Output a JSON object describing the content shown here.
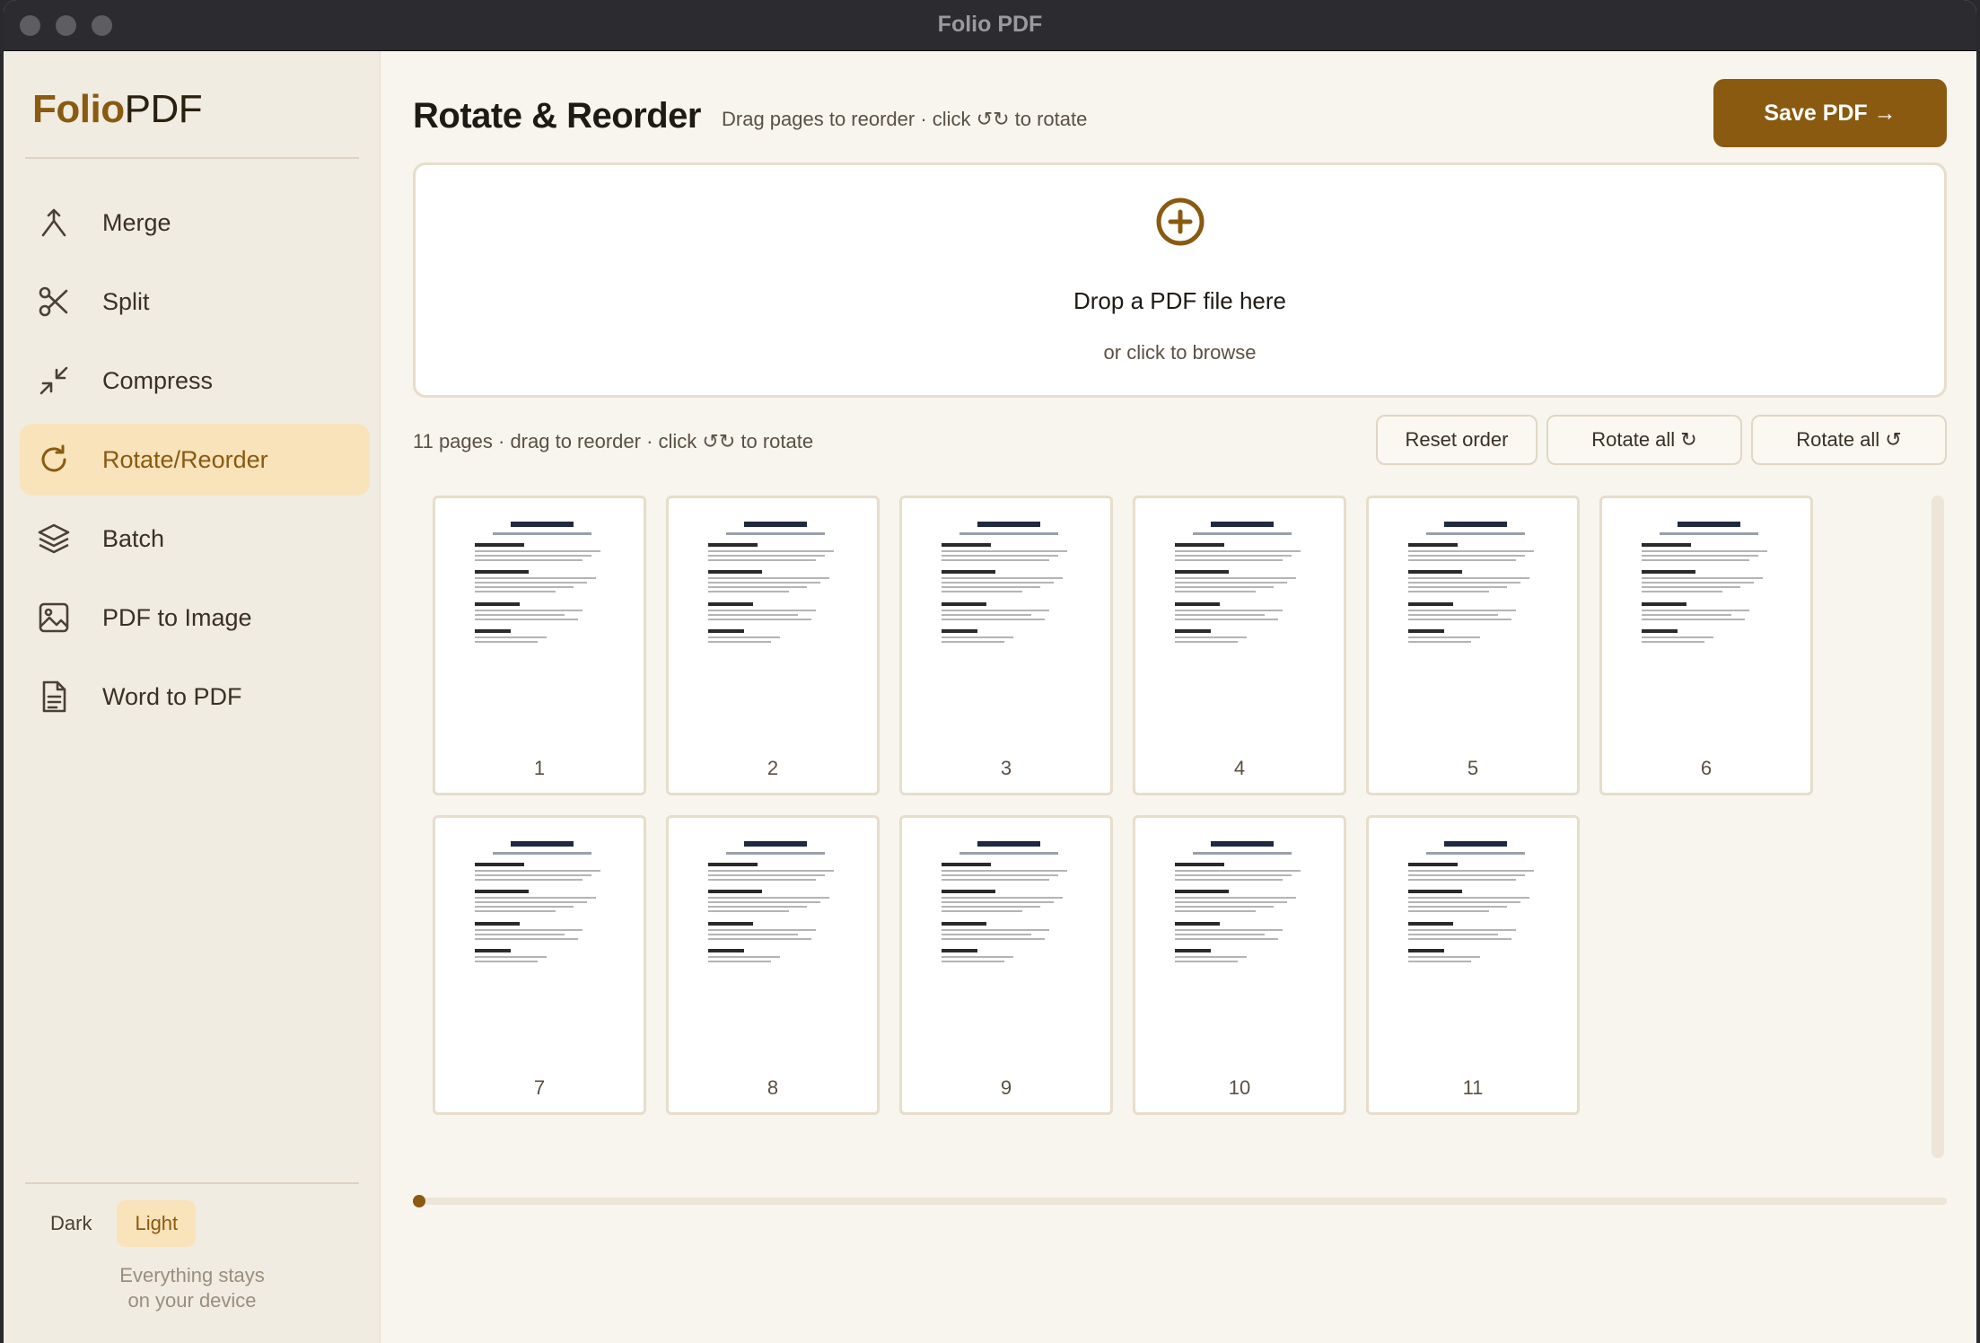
{
  "window": {
    "title": "Folio PDF"
  },
  "sidebar": {
    "brand_bold": "Folio",
    "brand_light": "PDF",
    "items": [
      {
        "label": "Merge",
        "icon": "merge-icon",
        "active": false
      },
      {
        "label": "Split",
        "icon": "scissors-icon",
        "active": false
      },
      {
        "label": "Compress",
        "icon": "compress-icon",
        "active": false
      },
      {
        "label": "Rotate/Reorder",
        "icon": "rotate-icon",
        "active": true
      },
      {
        "label": "Batch",
        "icon": "layers-icon",
        "active": false
      },
      {
        "label": "PDF to Image",
        "icon": "image-icon",
        "active": false
      },
      {
        "label": "Word to PDF",
        "icon": "document-icon",
        "active": false
      }
    ],
    "theme": {
      "dark_label": "Dark",
      "light_label": "Light",
      "selected": "Light"
    },
    "privacy_line1": "Everything stays",
    "privacy_line2": "on your device"
  },
  "main": {
    "title": "Rotate & Reorder",
    "subtitle": "Drag pages to reorder · click ↺↻ to rotate",
    "save_label": "Save PDF →",
    "dropzone": {
      "title": "Drop a PDF file here",
      "subtitle": "or click to browse"
    },
    "pages_info": "11 pages  ·  drag to reorder  ·  click ↺↻ to rotate",
    "toolbar": {
      "reset": "Reset order",
      "rotate_cw": "Rotate all ↻",
      "rotate_ccw": "Rotate all ↺"
    },
    "pages": [
      "1",
      "2",
      "3",
      "4",
      "5",
      "6",
      "7",
      "8",
      "9",
      "10",
      "11"
    ]
  },
  "colors": {
    "accent": "#8a5a10",
    "accent_soft": "#f8e3bb",
    "background": "#f8f5ee"
  }
}
